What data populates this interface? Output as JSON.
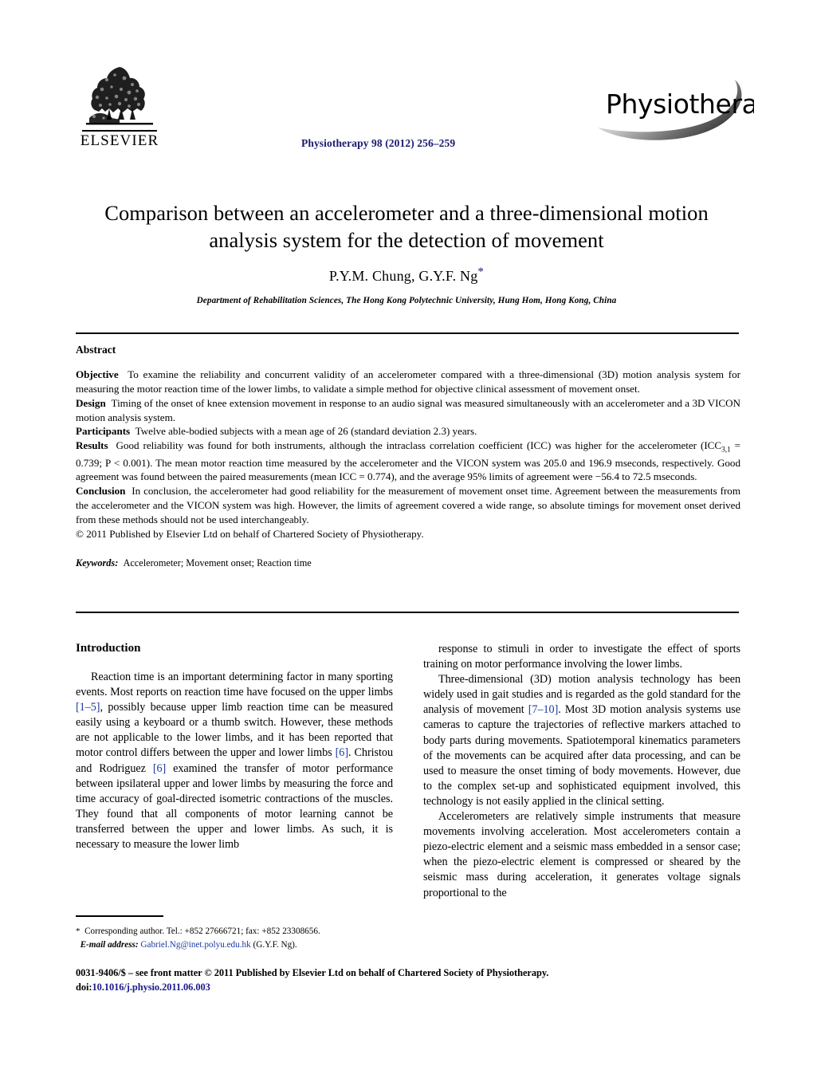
{
  "header": {
    "publisher_logo_name": "ELSEVIER",
    "journal_reference": "Physiotherapy 98 (2012) 256–259",
    "journal_logo_text": "Physiotherapy"
  },
  "title_block": {
    "title_line1": "Comparison between an accelerometer and a three-dimensional motion",
    "title_line2": "analysis system for the detection of movement",
    "authors": "P.Y.M. Chung, G.Y.F. Ng",
    "corresponding_marker": "*",
    "affiliation": "Department of Rehabilitation Sciences, The Hong Kong Polytechnic University, Hung Hom, Hong Kong, China"
  },
  "abstract": {
    "heading": "Abstract",
    "objective_label": "Objective",
    "objective_text": "To examine the reliability and concurrent validity of an accelerometer compared with a three-dimensional (3D) motion analysis system for measuring the motor reaction time of the lower limbs, to validate a simple method for objective clinical assessment of movement onset.",
    "design_label": "Design",
    "design_text": "Timing of the onset of knee extension movement in response to an audio signal was measured simultaneously with an accelerometer and a 3D VICON motion analysis system.",
    "participants_label": "Participants",
    "participants_text": "Twelve able-bodied subjects with a mean age of 26 (standard deviation 2.3) years.",
    "results_label": "Results",
    "results_text_part1": "Good reliability was found for both instruments, although the intraclass correlation coefficient (ICC) was higher for the accelerometer (ICC",
    "results_icc_subscript": "3,1",
    "results_text_part2": " = 0.739; P < 0.001). The mean motor reaction time measured by the accelerometer and the VICON system was 205.0 and 196.9 mseconds, respectively. Good agreement was found between the paired measurements (mean ICC = 0.774), and the average 95% limits of agreement were −56.4 to 72.5 mseconds.",
    "conclusion_label": "Conclusion",
    "conclusion_text": "In conclusion, the accelerometer had good reliability for the measurement of movement onset time. Agreement between the measurements from the accelerometer and the VICON system was high. However, the limits of agreement covered a wide range, so absolute timings for movement onset derived from these methods should not be used interchangeably.",
    "copyright": "© 2011 Published by Elsevier Ltd on behalf of Chartered Society of Physiotherapy.",
    "keywords_label": "Keywords:",
    "keywords_text": "Accelerometer; Movement onset; Reaction time"
  },
  "body": {
    "section_heading": "Introduction",
    "left_para1_a": "Reaction time is an important determining factor in many sporting events. Most reports on reaction time have focused on the upper limbs ",
    "left_para1_cite1": "[1–5]",
    "left_para1_b": ", possibly because upper limb reaction time can be measured easily using a keyboard or a thumb switch. However, these methods are not applicable to the lower limbs, and it has been reported that motor control differs between the upper and lower limbs ",
    "left_para1_cite2": "[6]",
    "left_para1_c": ". Christou and Rodriguez ",
    "left_para1_cite3": "[6]",
    "left_para1_d": " examined the transfer of motor performance between ipsilateral upper and lower limbs by measuring the force and time accuracy of goal-directed isometric contractions of the muscles. They found that all components of motor learning cannot be transferred between the upper and lower limbs. As such, it is necessary to measure the lower limb",
    "right_para1": "response to stimuli in order to investigate the effect of sports training on motor performance involving the lower limbs.",
    "right_para2_a": "Three-dimensional (3D) motion analysis technology has been widely used in gait studies and is regarded as the gold standard for the analysis of movement ",
    "right_para2_cite": "[7–10]",
    "right_para2_b": ". Most 3D motion analysis systems use cameras to capture the trajectories of reflective markers attached to body parts during movements. Spatiotemporal kinematics parameters of the movements can be acquired after data processing, and can be used to measure the onset timing of body movements. However, due to the complex set-up and sophisticated equipment involved, this technology is not easily applied in the clinical setting.",
    "right_para3": "Accelerometers are relatively simple instruments that measure movements involving acceleration. Most accelerometers contain a piezo-electric element and a seismic mass embedded in a sensor case; when the piezo-electric element is compressed or sheared by the seismic mass during acceleration, it generates voltage signals proportional to the"
  },
  "footnote": {
    "marker": "*",
    "corresponding_text": "Corresponding author. Tel.: +852 27666721; fax: +852 23308656.",
    "email_label": "E-mail address:",
    "email_address": "Gabriel.Ng@inet.polyu.edu.hk",
    "email_suffix": "(G.Y.F. Ng)."
  },
  "footer": {
    "front_matter": "0031-9406/$ – see front matter © 2011 Published by Elsevier Ltd on behalf of Chartered Society of Physiotherapy.",
    "doi_label": "doi:",
    "doi_value": "10.1016/j.physio.2011.06.003"
  },
  "colors": {
    "journal_blue": "#1a1a6e",
    "citation_blue": "#1a3a9e",
    "text_black": "#000000"
  }
}
